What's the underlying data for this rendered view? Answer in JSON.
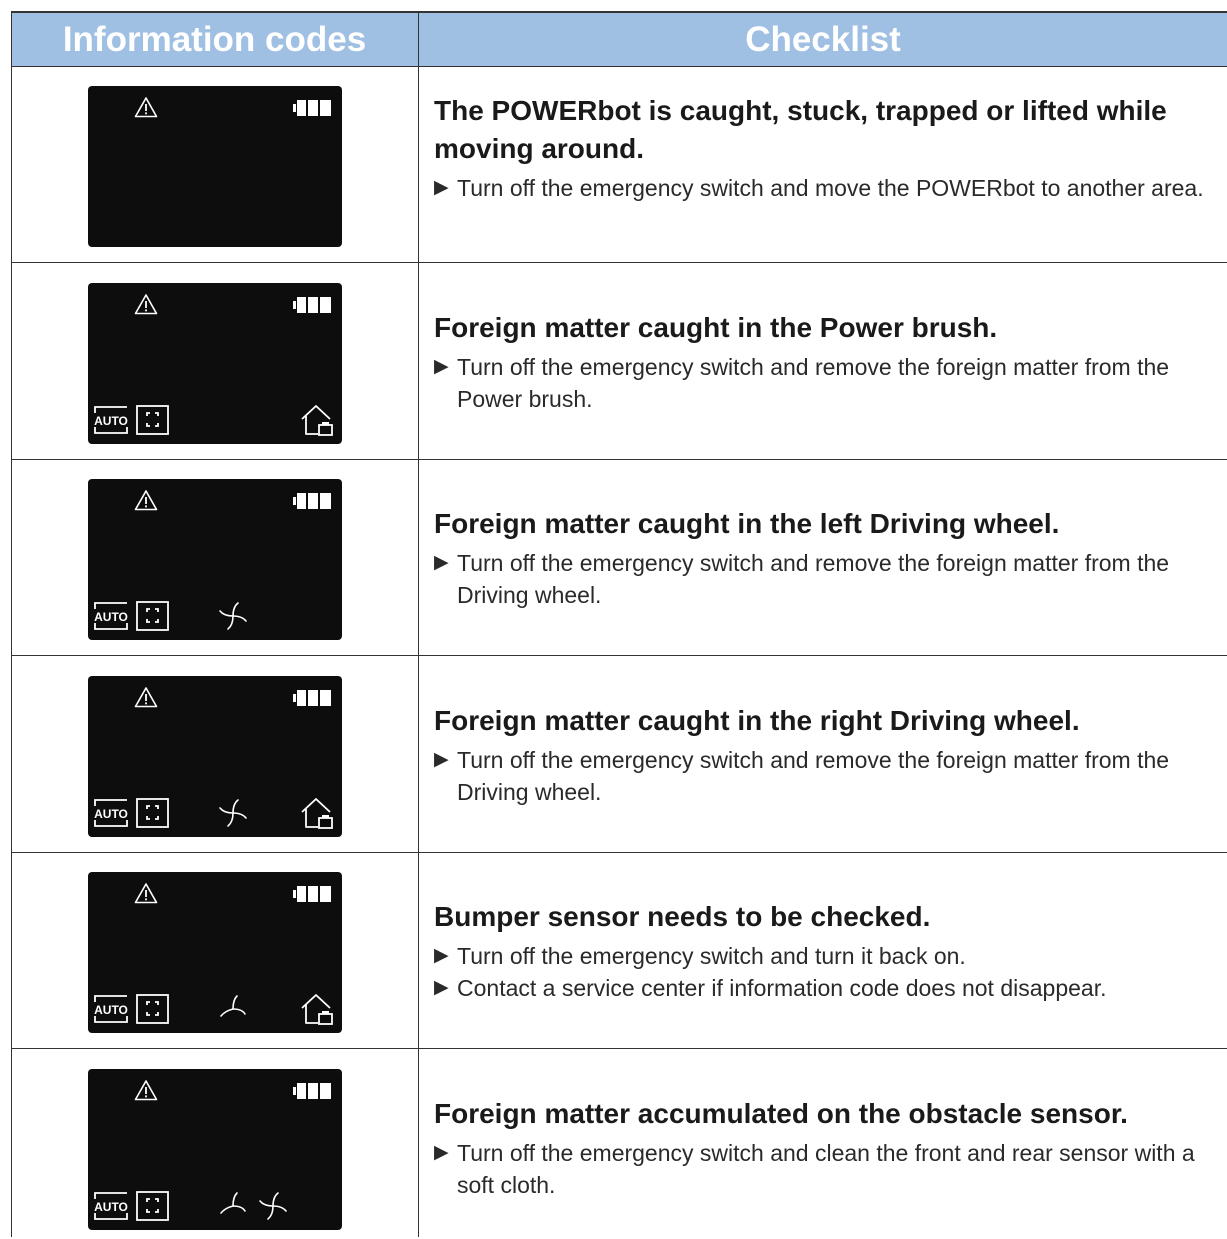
{
  "header": {
    "col1": "Information codes",
    "col2": "Checklist"
  },
  "rows": [
    {
      "title": "The POWERbot is caught, stuck, trapped or lifted while moving around.",
      "bullets": [
        "Turn off the emergency switch and move the POWERbot to another area."
      ],
      "display_icons": [
        "warning-icon",
        "battery-icon"
      ]
    },
    {
      "title": "Foreign matter caught in the Power brush.",
      "bullets": [
        "Turn off the emergency switch and remove the foreign matter from the Power brush."
      ],
      "display_icons": [
        "warning-icon",
        "battery-icon",
        "auto-mode-icon",
        "spot-mode-icon",
        "home-icon"
      ]
    },
    {
      "title": "Foreign matter caught in the left Driving wheel.",
      "bullets": [
        "Turn off the emergency switch and remove the foreign matter from the Driving wheel."
      ],
      "display_icons": [
        "warning-icon",
        "battery-icon",
        "auto-mode-icon",
        "spot-mode-icon",
        "fan-icon"
      ]
    },
    {
      "title": "Foreign matter caught in the right Driving wheel.",
      "bullets": [
        "Turn off the emergency switch and remove the foreign matter from the Driving wheel."
      ],
      "display_icons": [
        "warning-icon",
        "battery-icon",
        "auto-mode-icon",
        "spot-mode-icon",
        "fan-icon",
        "home-icon"
      ]
    },
    {
      "title": "Bumper sensor needs to be checked.",
      "bullets": [
        "Turn off the emergency switch and turn it back on.",
        "Contact a service center if information code does not disappear."
      ],
      "display_icons": [
        "warning-icon",
        "battery-icon",
        "auto-mode-icon",
        "spot-mode-icon",
        "half-fan-icon",
        "home-icon"
      ]
    },
    {
      "title": "Foreign matter accumulated on the obstacle sensor.",
      "bullets": [
        "Turn off the emergency switch and clean the front and rear sensor with a soft cloth."
      ],
      "display_icons": [
        "warning-icon",
        "battery-icon",
        "auto-mode-icon",
        "spot-mode-icon",
        "half-fan-icon",
        "fan-icon"
      ]
    }
  ],
  "colors": {
    "header_bg": "#9fbfe3",
    "lcd_bg": "#0d0d0d",
    "lcd_fg": "#ffffff"
  }
}
